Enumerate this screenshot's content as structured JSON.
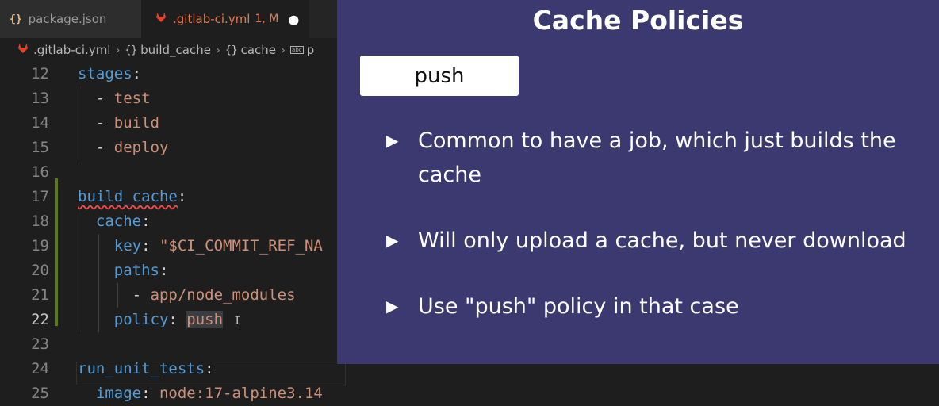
{
  "tabs": [
    {
      "label": "package.json",
      "icon": "braces-icon"
    },
    {
      "label": ".gitlab-ci.yml",
      "badge": "1, M",
      "icon": "gitlab-icon",
      "dirty": true
    }
  ],
  "breadcrumb": [
    ".gitlab-ci.yml",
    "build_cache",
    "cache",
    "p"
  ],
  "editor": {
    "lines": [
      {
        "num": "12",
        "tokens": [
          {
            "t": "stages",
            "c": "k"
          },
          {
            "t": ":",
            "c": "p"
          }
        ]
      },
      {
        "num": "13",
        "tokens": [
          {
            "t": "  - ",
            "c": "p"
          },
          {
            "t": "test",
            "c": "s"
          }
        ]
      },
      {
        "num": "14",
        "tokens": [
          {
            "t": "  - ",
            "c": "p"
          },
          {
            "t": "build",
            "c": "s"
          }
        ]
      },
      {
        "num": "15",
        "tokens": [
          {
            "t": "  - ",
            "c": "p"
          },
          {
            "t": "deploy",
            "c": "s"
          }
        ]
      },
      {
        "num": "16",
        "tokens": []
      },
      {
        "num": "17",
        "tokens": [
          {
            "t": "build_cache",
            "c": "w"
          },
          {
            "t": ":",
            "c": "p"
          }
        ]
      },
      {
        "num": "18",
        "tokens": [
          {
            "t": "  cache",
            "c": "k"
          },
          {
            "t": ":",
            "c": "p"
          }
        ]
      },
      {
        "num": "19",
        "tokens": [
          {
            "t": "    key",
            "c": "k"
          },
          {
            "t": ": ",
            "c": "p"
          },
          {
            "t": "\"$CI_COMMIT_REF_NA",
            "c": "s"
          }
        ]
      },
      {
        "num": "20",
        "tokens": [
          {
            "t": "    paths",
            "c": "k"
          },
          {
            "t": ":",
            "c": "p"
          }
        ]
      },
      {
        "num": "21",
        "tokens": [
          {
            "t": "      - ",
            "c": "p"
          },
          {
            "t": "app/node_modules",
            "c": "s"
          }
        ]
      },
      {
        "num": "22",
        "tokens": [
          {
            "t": "    policy",
            "c": "k"
          },
          {
            "t": ": ",
            "c": "p"
          },
          {
            "t": "push",
            "c": "s hl"
          }
        ],
        "active": true,
        "cursor": "I"
      },
      {
        "num": "23",
        "tokens": []
      },
      {
        "num": "24",
        "tokens": [
          {
            "t": "run_unit_tests",
            "c": "k"
          },
          {
            "t": ":",
            "c": "p"
          }
        ]
      },
      {
        "num": "25",
        "tokens": [
          {
            "t": "  image",
            "c": "k"
          },
          {
            "t": ": ",
            "c": "p"
          },
          {
            "t": "node:17-alpine3.14",
            "c": "s"
          }
        ]
      }
    ]
  },
  "slide": {
    "title": "Cache Policies",
    "keyword": "push",
    "bullets": [
      "Common to have a job, which just builds the cache",
      "Will only upload a cache, but never download",
      "Use \"push\" policy in that case"
    ],
    "bullet_glyph": "▶",
    "background": "#3c3970"
  }
}
